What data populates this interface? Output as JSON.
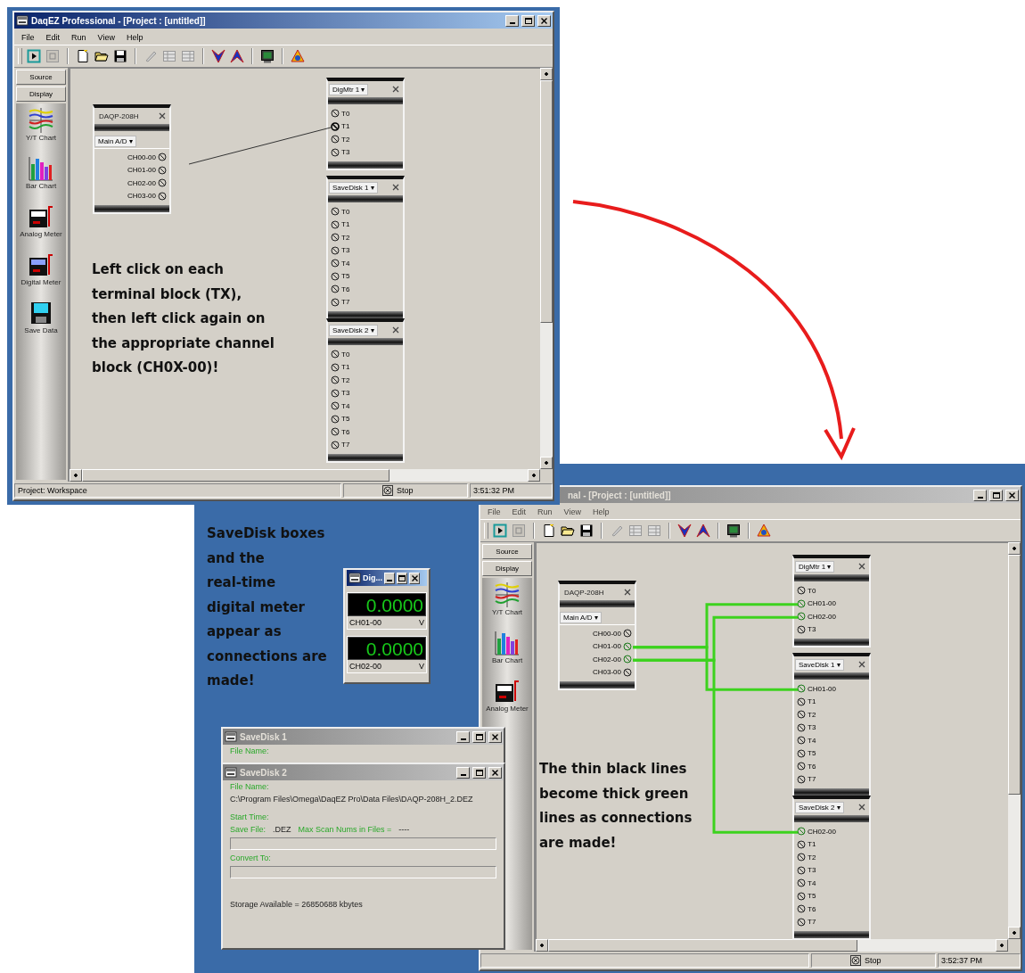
{
  "windows": [
    {
      "title": "DaqEZ Professional - [Project : [untitled]]",
      "active": true,
      "menu": [
        "File",
        "Edit",
        "Run",
        "View",
        "Help"
      ],
      "sidebar": {
        "tabs": [
          "Source",
          "Display"
        ],
        "items": [
          "Y/T Chart",
          "Bar Chart",
          "Analog Meter",
          "Digital Meter",
          "Save Data"
        ]
      },
      "canvas": {
        "blocks": [
          {
            "kind": "source",
            "title": "DAQP-208H",
            "mode": "Main A/D ▾",
            "terminals": [
              {
                "label": "CH00-00",
                "connected": false,
                "pending": false
              },
              {
                "label": "CH01-00",
                "connected": false,
                "pending": false
              },
              {
                "label": "CH02-00",
                "connected": false,
                "pending": false
              },
              {
                "label": "CH03-00",
                "connected": false,
                "pending": false
              }
            ]
          },
          {
            "kind": "sink",
            "title": "DigMtr 1 ▾",
            "terminals": [
              {
                "label": "T0",
                "connected": false,
                "pending": false
              },
              {
                "label": "T1",
                "connected": false,
                "pending": true
              },
              {
                "label": "T2",
                "connected": false,
                "pending": false
              },
              {
                "label": "T3",
                "connected": false,
                "pending": false
              }
            ]
          },
          {
            "kind": "sink",
            "title": "SaveDisk 1 ▾",
            "terminals": [
              {
                "label": "T0",
                "connected": false,
                "pending": false
              },
              {
                "label": "T1",
                "connected": false,
                "pending": false
              },
              {
                "label": "T2",
                "connected": false,
                "pending": false
              },
              {
                "label": "T3",
                "connected": false,
                "pending": false
              },
              {
                "label": "T4",
                "connected": false,
                "pending": false
              },
              {
                "label": "T5",
                "connected": false,
                "pending": false
              },
              {
                "label": "T6",
                "connected": false,
                "pending": false
              },
              {
                "label": "T7",
                "connected": false,
                "pending": false
              }
            ]
          },
          {
            "kind": "sink",
            "title": "SaveDisk 2 ▾",
            "terminals": [
              {
                "label": "T0",
                "connected": false,
                "pending": false
              },
              {
                "label": "T1",
                "connected": false,
                "pending": false
              },
              {
                "label": "T2",
                "connected": false,
                "pending": false
              },
              {
                "label": "T3",
                "connected": false,
                "pending": false
              },
              {
                "label": "T4",
                "connected": false,
                "pending": false
              },
              {
                "label": "T5",
                "connected": false,
                "pending": false
              },
              {
                "label": "T6",
                "connected": false,
                "pending": false
              },
              {
                "label": "T7",
                "connected": false,
                "pending": false
              }
            ]
          }
        ],
        "note": "Left click on each\nterminal block (TX),\nthen left click again on\nthe appropriate channel\nblock (CH0X-00)!"
      },
      "status_bar": {
        "project": "Project: Workspace",
        "stop": "Stop",
        "time": "3:51:32 PM"
      }
    },
    {
      "title": "nal - [Project : [untitled]]",
      "active": false,
      "menu": [
        "File",
        "Edit",
        "Run",
        "View",
        "Help"
      ],
      "sidebar": {
        "tabs": [
          "Source",
          "Display"
        ],
        "items": [
          "Y/T Chart",
          "Bar Chart",
          "Analog Meter"
        ]
      },
      "canvas": {
        "blocks": [
          {
            "kind": "source",
            "title": "DAQP-208H",
            "mode": "Main A/D ▾",
            "terminals": [
              {
                "label": "CH00-00",
                "connected": false,
                "pending": false
              },
              {
                "label": "CH01-00",
                "connected": true,
                "pending": false
              },
              {
                "label": "CH02-00",
                "connected": true,
                "pending": false
              },
              {
                "label": "CH03-00",
                "connected": false,
                "pending": false
              }
            ]
          },
          {
            "kind": "sink",
            "title": "DigMtr 1 ▾",
            "terminals": [
              {
                "label": "T0",
                "connected": false,
                "pending": false
              },
              {
                "label": "CH01-00",
                "connected": true,
                "pending": false
              },
              {
                "label": "CH02-00",
                "connected": true,
                "pending": false
              },
              {
                "label": "T3",
                "connected": false,
                "pending": false
              }
            ]
          },
          {
            "kind": "sink",
            "title": "SaveDisk 1 ▾",
            "terminals": [
              {
                "label": "CH01-00",
                "connected": true,
                "pending": false
              },
              {
                "label": "T1",
                "connected": false,
                "pending": false
              },
              {
                "label": "T2",
                "connected": false,
                "pending": false
              },
              {
                "label": "T3",
                "connected": false,
                "pending": false
              },
              {
                "label": "T4",
                "connected": false,
                "pending": false
              },
              {
                "label": "T5",
                "connected": false,
                "pending": false
              },
              {
                "label": "T6",
                "connected": false,
                "pending": false
              },
              {
                "label": "T7",
                "connected": false,
                "pending": false
              }
            ]
          },
          {
            "kind": "sink",
            "title": "SaveDisk 2 ▾",
            "terminals": [
              {
                "label": "CH02-00",
                "connected": true,
                "pending": false
              },
              {
                "label": "T1",
                "connected": false,
                "pending": false
              },
              {
                "label": "T2",
                "connected": false,
                "pending": false
              },
              {
                "label": "T3",
                "connected": false,
                "pending": false
              },
              {
                "label": "T4",
                "connected": false,
                "pending": false
              },
              {
                "label": "T5",
                "connected": false,
                "pending": false
              },
              {
                "label": "T6",
                "connected": false,
                "pending": false
              },
              {
                "label": "T7",
                "connected": false,
                "pending": false
              }
            ]
          }
        ],
        "note": "The thin black lines\nbecome thick green\nlines as connections\nare made!"
      },
      "status_bar": {
        "stop": "Stop",
        "time": "3:52:37 PM"
      }
    }
  ],
  "desktop_note": "SaveDisk boxes\nand the\nreal-time\ndigital meter\nappear as\nconnections are\nmade!",
  "digital_meter": {
    "title": "Dig...",
    "displays": [
      {
        "value": "0.0000",
        "channel": "CH01-00",
        "unit": "V"
      },
      {
        "value": "0.0000",
        "channel": "CH02-00",
        "unit": "V"
      }
    ]
  },
  "savedisk_windows": [
    {
      "title": "SaveDisk 1",
      "file_name_label": "File Name:"
    },
    {
      "title": "SaveDisk 2",
      "file_name_label": "File Name:",
      "file_path": "C:\\Program Files\\Omega\\DaqEZ Pro\\Data Files\\DAQP-208H_2.DEZ",
      "start_time_label": "Start Time:",
      "save_file_label": "Save File:",
      "save_file_value": ".DEZ",
      "max_scan_label": "Max Scan Nums in Files =",
      "max_scan_value": "----",
      "convert_label": "Convert To:",
      "storage": "Storage Available = 26850688 kbytes"
    }
  ]
}
